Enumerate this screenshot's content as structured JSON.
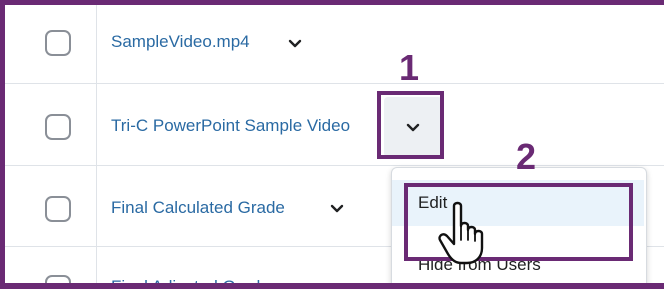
{
  "rows": [
    {
      "title": "SampleVideo.mp4"
    },
    {
      "title": "Tri-C PowerPoint Sample Video"
    },
    {
      "title": "Final Calculated Grade"
    },
    {
      "title": "Final Adjusted Grade"
    }
  ],
  "annotations": {
    "step1": "1",
    "step2": "2"
  },
  "menu": {
    "items": [
      {
        "label": "Edit"
      },
      {
        "label": "Hide from Users"
      }
    ]
  },
  "colors": {
    "link": "#2a6aa3",
    "annotation_purple": "#6a2a74",
    "menu_hover": "#e9f3fb"
  }
}
